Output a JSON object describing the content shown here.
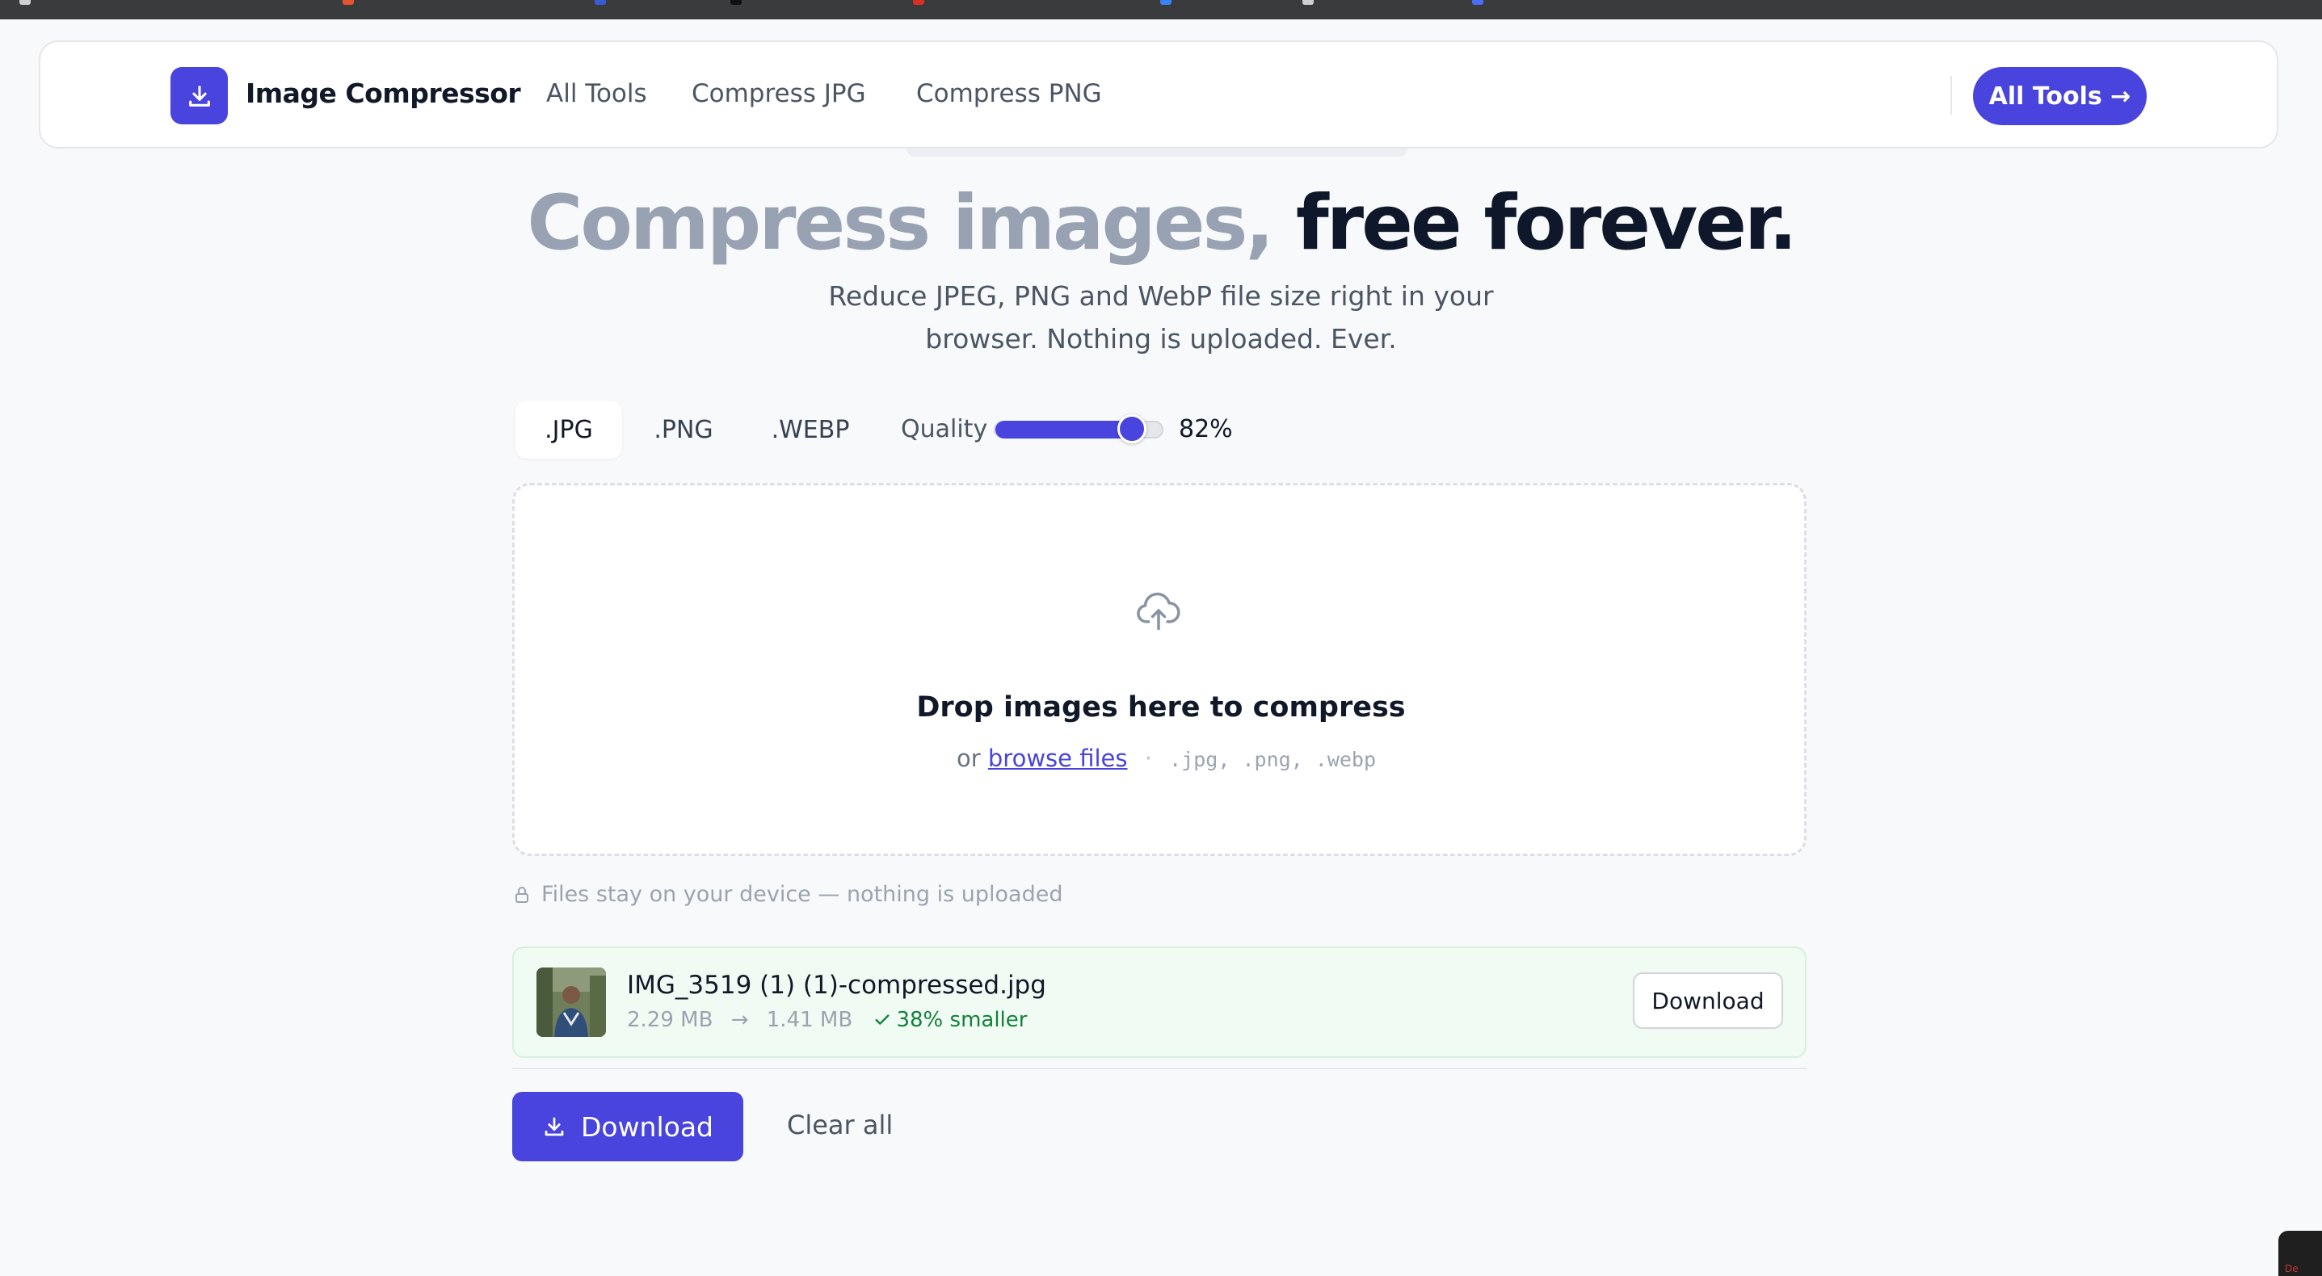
{
  "brand": {
    "name": "Image Compressor",
    "icon": "download-icon",
    "accent": "#4844dd"
  },
  "nav": {
    "links": [
      "All Tools",
      "Compress JPG",
      "Compress PNG"
    ],
    "cta": "All Tools →"
  },
  "hero": {
    "title_muted": "Compress images,",
    "title_dark": "free forever.",
    "subtitle_line1": "Reduce JPEG, PNG and WebP file size right in your",
    "subtitle_line2": "browser. Nothing is uploaded. Ever."
  },
  "format_tabs": {
    "items": [
      ".JPG",
      ".PNG",
      ".WEBP"
    ],
    "selected": ".JPG"
  },
  "quality": {
    "label": "Quality",
    "value": 82,
    "display": "82%"
  },
  "dropzone": {
    "icon": "cloud-upload-icon",
    "title": "Drop images here to compress",
    "or_text": "or",
    "browse_label": "browse files",
    "separator": "·",
    "extensions": ".jpg, .png, .webp"
  },
  "privacy": {
    "icon": "lock-icon",
    "text": "Files stay on your device — nothing is uploaded"
  },
  "files": [
    {
      "name": "IMG_3519 (1) (1)-compressed.jpg",
      "original_size": "2.29 MB",
      "arrow": "→",
      "compressed_size": "1.41 MB",
      "saved": "38% smaller",
      "download_label": "Download"
    }
  ],
  "actions": {
    "download_all": "Download",
    "clear_all": "Clear all"
  },
  "corner_widget_text": "De"
}
